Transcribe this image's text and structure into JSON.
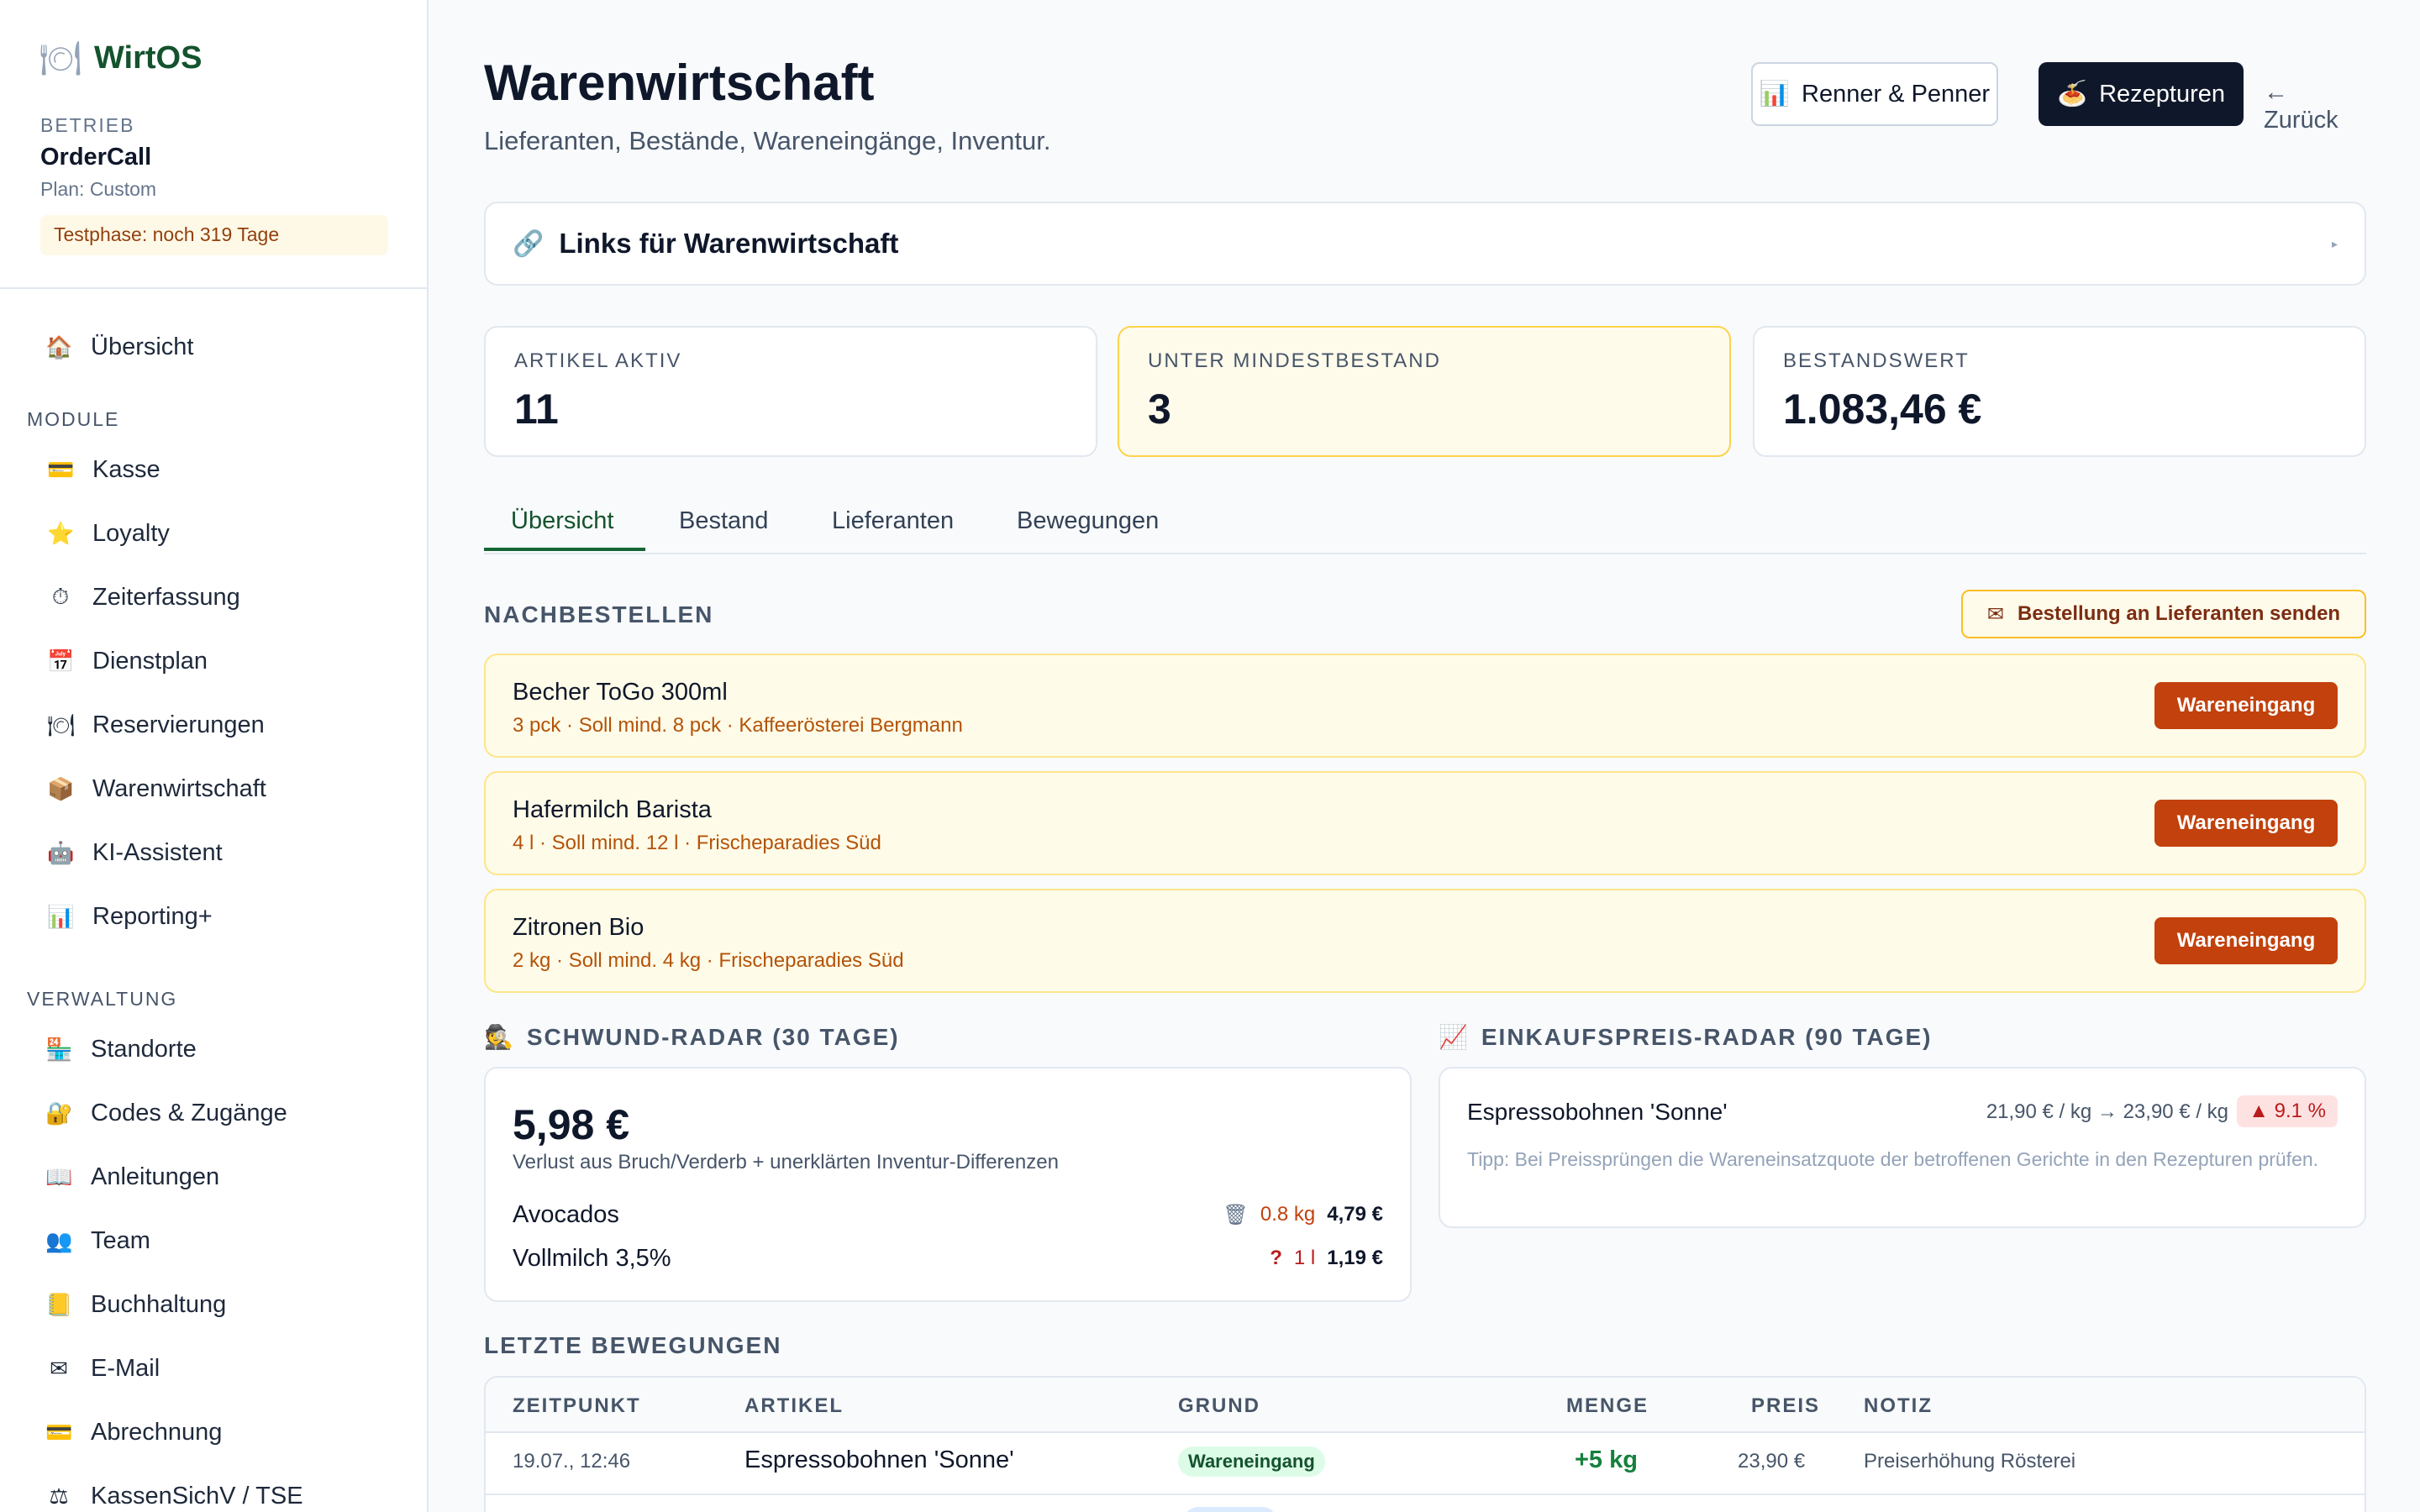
{
  "app": {
    "brand_icon": "plate-icon",
    "brand_name": "WirtOS"
  },
  "betrieb": {
    "label": "BETRIEB",
    "name": "OrderCall",
    "plan": "Plan: Custom",
    "trial": "Testphase: noch 319 Tage"
  },
  "sidebar": {
    "top": [
      {
        "icon": "🏠",
        "label": "Übersicht"
      }
    ],
    "module_label": "MODULE",
    "module": [
      {
        "icon": "💳",
        "label": "Kasse"
      },
      {
        "icon": "⭐",
        "label": "Loyalty"
      },
      {
        "icon": "⏱",
        "label": "Zeiterfassung"
      },
      {
        "icon": "📅",
        "label": "Dienstplan"
      },
      {
        "icon": "🍽",
        "label": "Reservierungen"
      },
      {
        "icon": "📦",
        "label": "Warenwirtschaft"
      },
      {
        "icon": "🤖",
        "label": "KI-Assistent"
      },
      {
        "icon": "📊",
        "label": "Reporting+"
      }
    ],
    "verwaltung_label": "VERWALTUNG",
    "verwaltung": [
      {
        "icon": "🏪",
        "label": "Standorte"
      },
      {
        "icon": "🔐",
        "label": "Codes & Zugänge"
      },
      {
        "icon": "📖",
        "label": "Anleitungen"
      },
      {
        "icon": "👥",
        "label": "Team"
      },
      {
        "icon": "📒",
        "label": "Buchhaltung"
      },
      {
        "icon": "✉",
        "label": "E-Mail"
      },
      {
        "icon": "💳",
        "label": "Abrechnung"
      },
      {
        "icon": "⚖",
        "label": "KassenSichV / TSE"
      }
    ]
  },
  "header": {
    "title": "Warenwirtschaft",
    "subtitle": "Lieferanten, Bestände, Wareneingänge, Inventur.",
    "btn_renner": "Renner & Penner",
    "btn_rezepturen": "Rezepturen",
    "back": "← Zurück"
  },
  "links": {
    "title": "Links für Warenwirtschaft",
    "caret": "▸"
  },
  "stats": [
    {
      "label": "ARTIKEL AKTIV",
      "value": "11"
    },
    {
      "label": "UNTER MINDESTBESTAND",
      "value": "3"
    },
    {
      "label": "BESTANDSWERT",
      "value": "1.083,46 €"
    }
  ],
  "tabs": [
    "Übersicht",
    "Bestand",
    "Lieferanten",
    "Bewegungen"
  ],
  "nachbestellen": {
    "title": "NACHBESTELLEN",
    "order_button": "Bestellung an Lieferanten senden",
    "items": [
      {
        "name": "Becher ToGo 300ml",
        "meta": "3 pck · Soll mind. 8 pck · Kaffeerösterei Bergmann",
        "action": "Wareneingang"
      },
      {
        "name": "Hafermilch Barista",
        "meta": "4 l · Soll mind. 12 l · Frischeparadies Süd",
        "action": "Wareneingang"
      },
      {
        "name": "Zitronen Bio",
        "meta": "2 kg · Soll mind. 4 kg · Frischeparadies Süd",
        "action": "Wareneingang"
      }
    ]
  },
  "schwund": {
    "title": "SCHWUND-RADAR (30 TAGE)",
    "value": "5,98 €",
    "desc": "Verlust aus Bruch/Verderb + unerklärten Inventur-Differenzen",
    "rows": [
      {
        "name": "Avocados",
        "icon": "🗑",
        "qty": "0.8 kg",
        "amount": "4,79 €"
      },
      {
        "name": "Vollmilch 3,5%",
        "icon": "?",
        "qty": "1 l",
        "amount": "1,19 €"
      }
    ]
  },
  "preis": {
    "title": "EINKAUFSPREIS-RADAR (90 TAGE)",
    "article": "Espressobohnen 'Sonne'",
    "range": "21,90 € / kg → 23,90 € / kg",
    "change": "▲ 9.1 %",
    "tip": "Tipp: Bei Preissprüngen die Wareneinsatzquote der betroffenen Gerichte in den Rezepturen prüfen."
  },
  "bewegungen": {
    "title": "LETZTE BEWEGUNGEN",
    "columns": [
      "ZEITPUNKT",
      "ARTIKEL",
      "GRUND",
      "MENGE",
      "PREIS",
      "NOTIZ"
    ],
    "rows": [
      {
        "time": "19.07., 12:46",
        "article": "Espressobohnen 'Sonne'",
        "reason": "Wareneingang",
        "qty": "+5 kg",
        "price": "23,90 €",
        "note": "Preiserhöhung Rösterei"
      }
    ]
  },
  "colors": {
    "accent": "#14532d",
    "warning_bg": "#fffbeb",
    "action": "#c2410c",
    "dark": "#0f172a"
  }
}
